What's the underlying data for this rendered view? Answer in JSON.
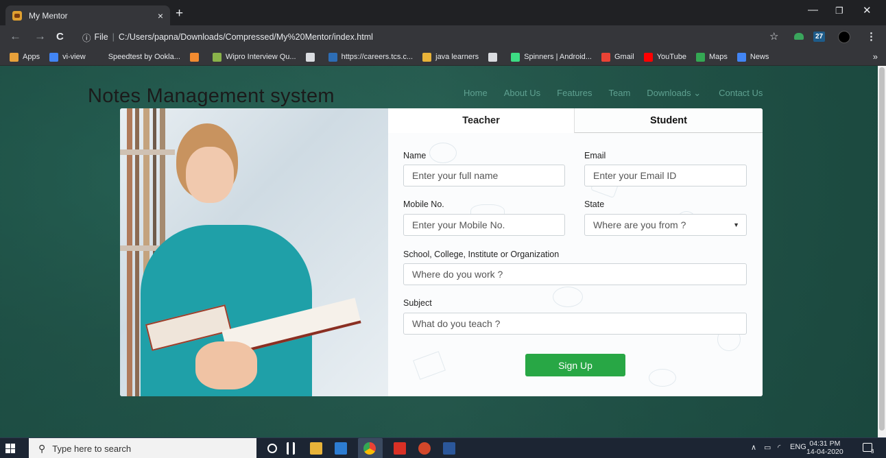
{
  "browser": {
    "tab_title": "My Mentor",
    "tab_close": "×",
    "new_tab": "+",
    "file_label": "File",
    "url": "C:/Users/papna/Downloads/Compressed/My%20Mentor/index.html",
    "ext_badge": "27",
    "bookmarks": [
      {
        "label": "Apps",
        "color": "#e8a13a"
      },
      {
        "label": "vi-view",
        "color": "#4285f4"
      },
      {
        "label": "Speedtest by Ookla...",
        "color": "#35363a"
      },
      {
        "label": "",
        "color": "#f28b30"
      },
      {
        "label": "Wipro Interview Qu...",
        "color": "#8ab34a"
      },
      {
        "label": "",
        "color": "#dadce0"
      },
      {
        "label": "https://careers.tcs.c...",
        "color": "#2d6db5"
      },
      {
        "label": "java learners",
        "color": "#e8b339"
      },
      {
        "label": "",
        "color": "#dadce0"
      },
      {
        "label": "Spinners | Android...",
        "color": "#3ddc84"
      },
      {
        "label": "Gmail",
        "color": "#ea4335"
      },
      {
        "label": "YouTube",
        "color": "#ff0000"
      },
      {
        "label": "Maps",
        "color": "#34a853"
      },
      {
        "label": "News",
        "color": "#4285f4"
      }
    ],
    "more": "»"
  },
  "site": {
    "brand": "Notes Management system",
    "nav": [
      "Home",
      "About Us",
      "Features",
      "Team",
      "Downloads ⌄",
      "Contact Us"
    ]
  },
  "form": {
    "tab_teacher": "Teacher",
    "tab_student": "Student",
    "name_label": "Name",
    "name_placeholder": "Enter your full name",
    "email_label": "Email",
    "email_placeholder": "Enter your Email ID",
    "mobile_label": "Mobile No.",
    "mobile_placeholder": "Enter your Mobile No.",
    "state_label": "State",
    "state_value": "Where are you from ?",
    "school_label": "School, College, Institute or Organization",
    "school_placeholder": "Where do you work ?",
    "subject_label": "Subject",
    "subject_placeholder": "What do you teach ?",
    "submit": "Sign Up"
  },
  "taskbar": {
    "search_placeholder": "Type here to search",
    "lang": "ENG",
    "time": "04:31 PM",
    "date": "14-04-2020",
    "notif_count": "3"
  }
}
